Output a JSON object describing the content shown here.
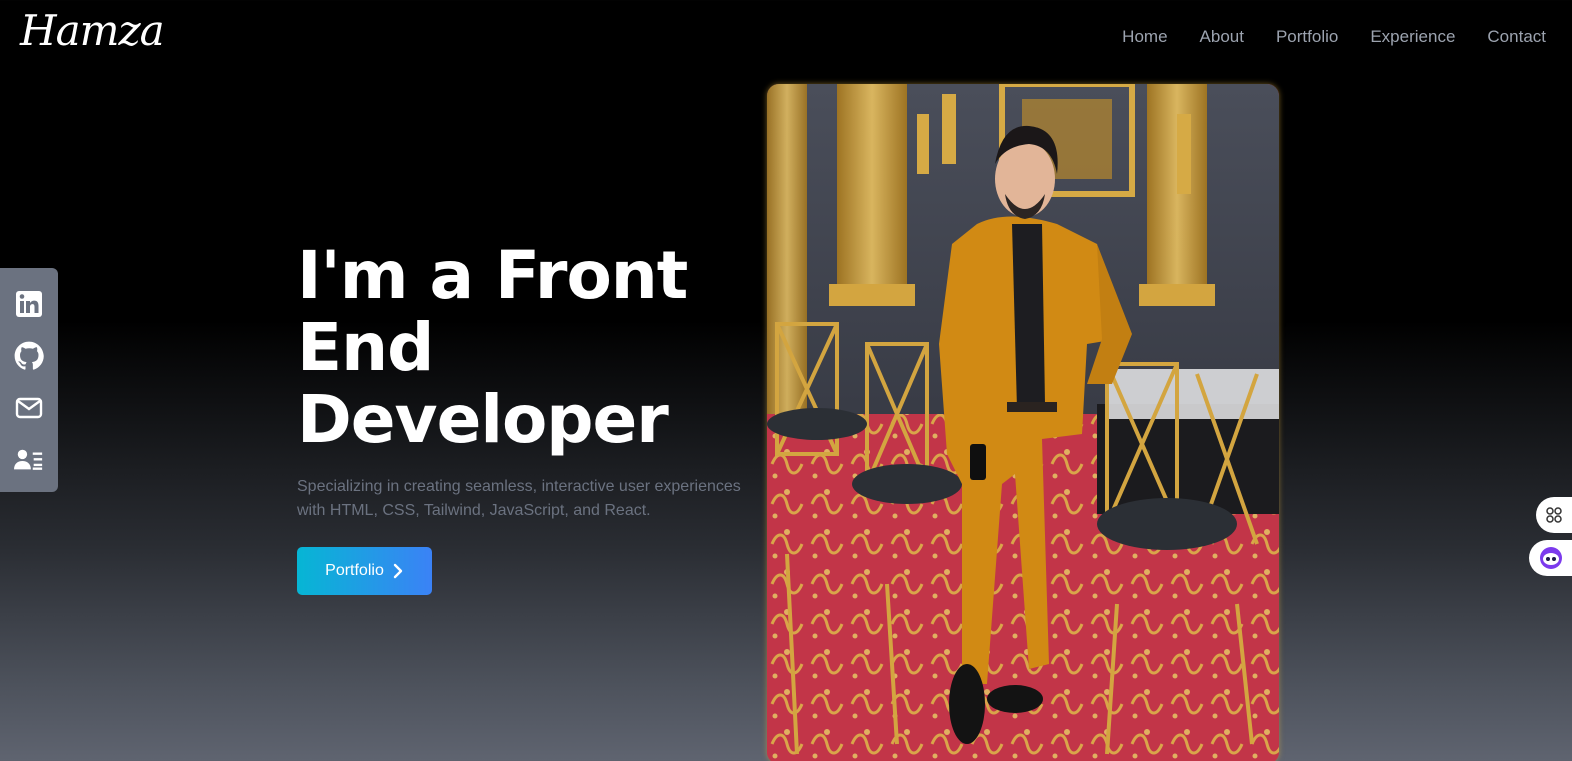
{
  "header": {
    "logo": "Hamza",
    "nav": [
      "Home",
      "About",
      "Portfolio",
      "Experience",
      "Contact"
    ]
  },
  "social": {
    "icons": [
      "linkedin-icon",
      "github-icon",
      "mail-icon",
      "resume-icon"
    ]
  },
  "hero": {
    "title": "I'm a Front End Developer",
    "subtitle": "Specializing in creating seamless, interactive user experiences with HTML, CSS, Tailwind, JavaScript, and React.",
    "cta_label": "Portfolio"
  },
  "widgets": [
    "apps-grid-icon",
    "assistant-bot-icon"
  ],
  "colors": {
    "accent_start": "#06b6d4",
    "accent_end": "#3b82f6",
    "sidebar": "#6b7280",
    "nav_text": "#9ca3af"
  }
}
